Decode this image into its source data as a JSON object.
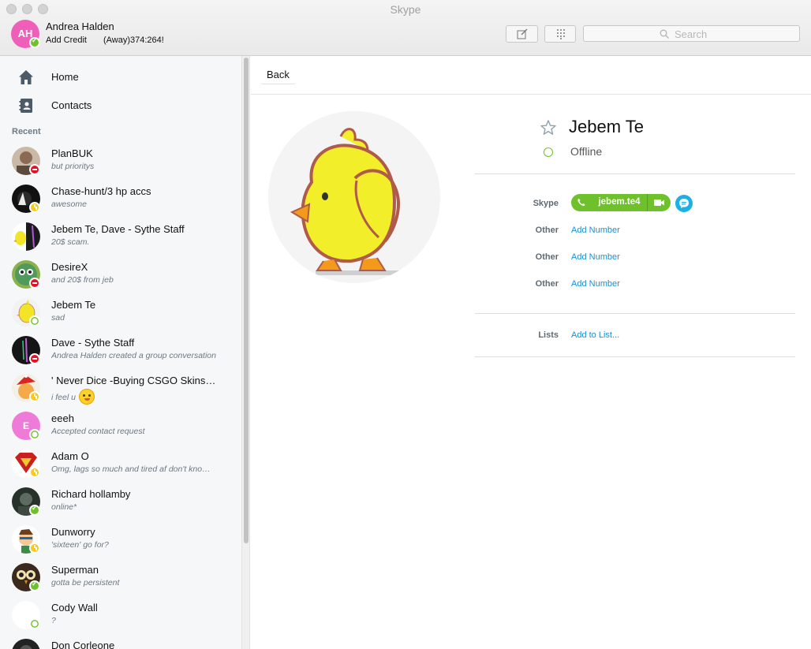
{
  "window": {
    "title": "Skype"
  },
  "me": {
    "initials": "AH",
    "name": "Andrea Halden",
    "add_credit_label": "Add Credit",
    "mood": "(Away)374:264!",
    "status": "online"
  },
  "header": {
    "search_placeholder": "Search",
    "compose_icon": "compose-icon",
    "dialpad_icon": "dialpad-icon"
  },
  "sidebar": {
    "nav": [
      {
        "label": "Home",
        "icon": "home-icon"
      },
      {
        "label": "Contacts",
        "icon": "contacts-icon"
      }
    ],
    "recent_heading": "Recent",
    "conversations": [
      {
        "name": "PlanBUK",
        "subtitle": "but prioritys",
        "status": "dnd"
      },
      {
        "name": "Chase-hunt/3 hp accs",
        "subtitle": "awesome",
        "status": "away"
      },
      {
        "name": "Jebem Te, Dave - Sythe Staff",
        "subtitle": "20$ scam.",
        "status": "none"
      },
      {
        "name": "DesireX",
        "subtitle": "and 20$ from jeb",
        "status": "dnd"
      },
      {
        "name": "Jebem Te",
        "subtitle": "sad",
        "status": "offline"
      },
      {
        "name": "Dave - Sythe Staff",
        "subtitle": "Andrea Halden created a group conversation",
        "status": "dnd"
      },
      {
        "name": "' Never Dice -Buying CSGO Skins…",
        "subtitle": "i feel u",
        "status": "away"
      },
      {
        "name": "eeeh",
        "subtitle": "Accepted contact request",
        "status": "offline",
        "initial": "E"
      },
      {
        "name": "Adam O",
        "subtitle": "Omg, lags so much and tired af don't kno…",
        "status": "away"
      },
      {
        "name": "Richard hollamby",
        "subtitle": "online*",
        "status": "online"
      },
      {
        "name": "Dunworry",
        "subtitle": "'sixteen' go for?",
        "status": "away"
      },
      {
        "name": "Superman",
        "subtitle": "gotta be persistent",
        "status": "online"
      },
      {
        "name": "Cody Wall",
        "subtitle": "?",
        "status": "offline"
      },
      {
        "name": "Don Corleone",
        "subtitle": "",
        "status": "none"
      }
    ]
  },
  "main": {
    "back_label": "Back",
    "profile": {
      "name": "Jebem Te",
      "presence": "Offline",
      "skype_label": "Skype",
      "skype_id": "jebem.te4",
      "other_label": "Other",
      "add_number_label": "Add Number",
      "lists_label": "Lists",
      "add_to_list_label": "Add to List..."
    }
  },
  "colors": {
    "online_green": "#6fc12b",
    "away_yellow": "#f8c91b",
    "dnd_red": "#e81123",
    "link_blue": "#1a8fd1",
    "chat_blue": "#1cb0e8",
    "avatar_pink": "#ef5fb9"
  }
}
